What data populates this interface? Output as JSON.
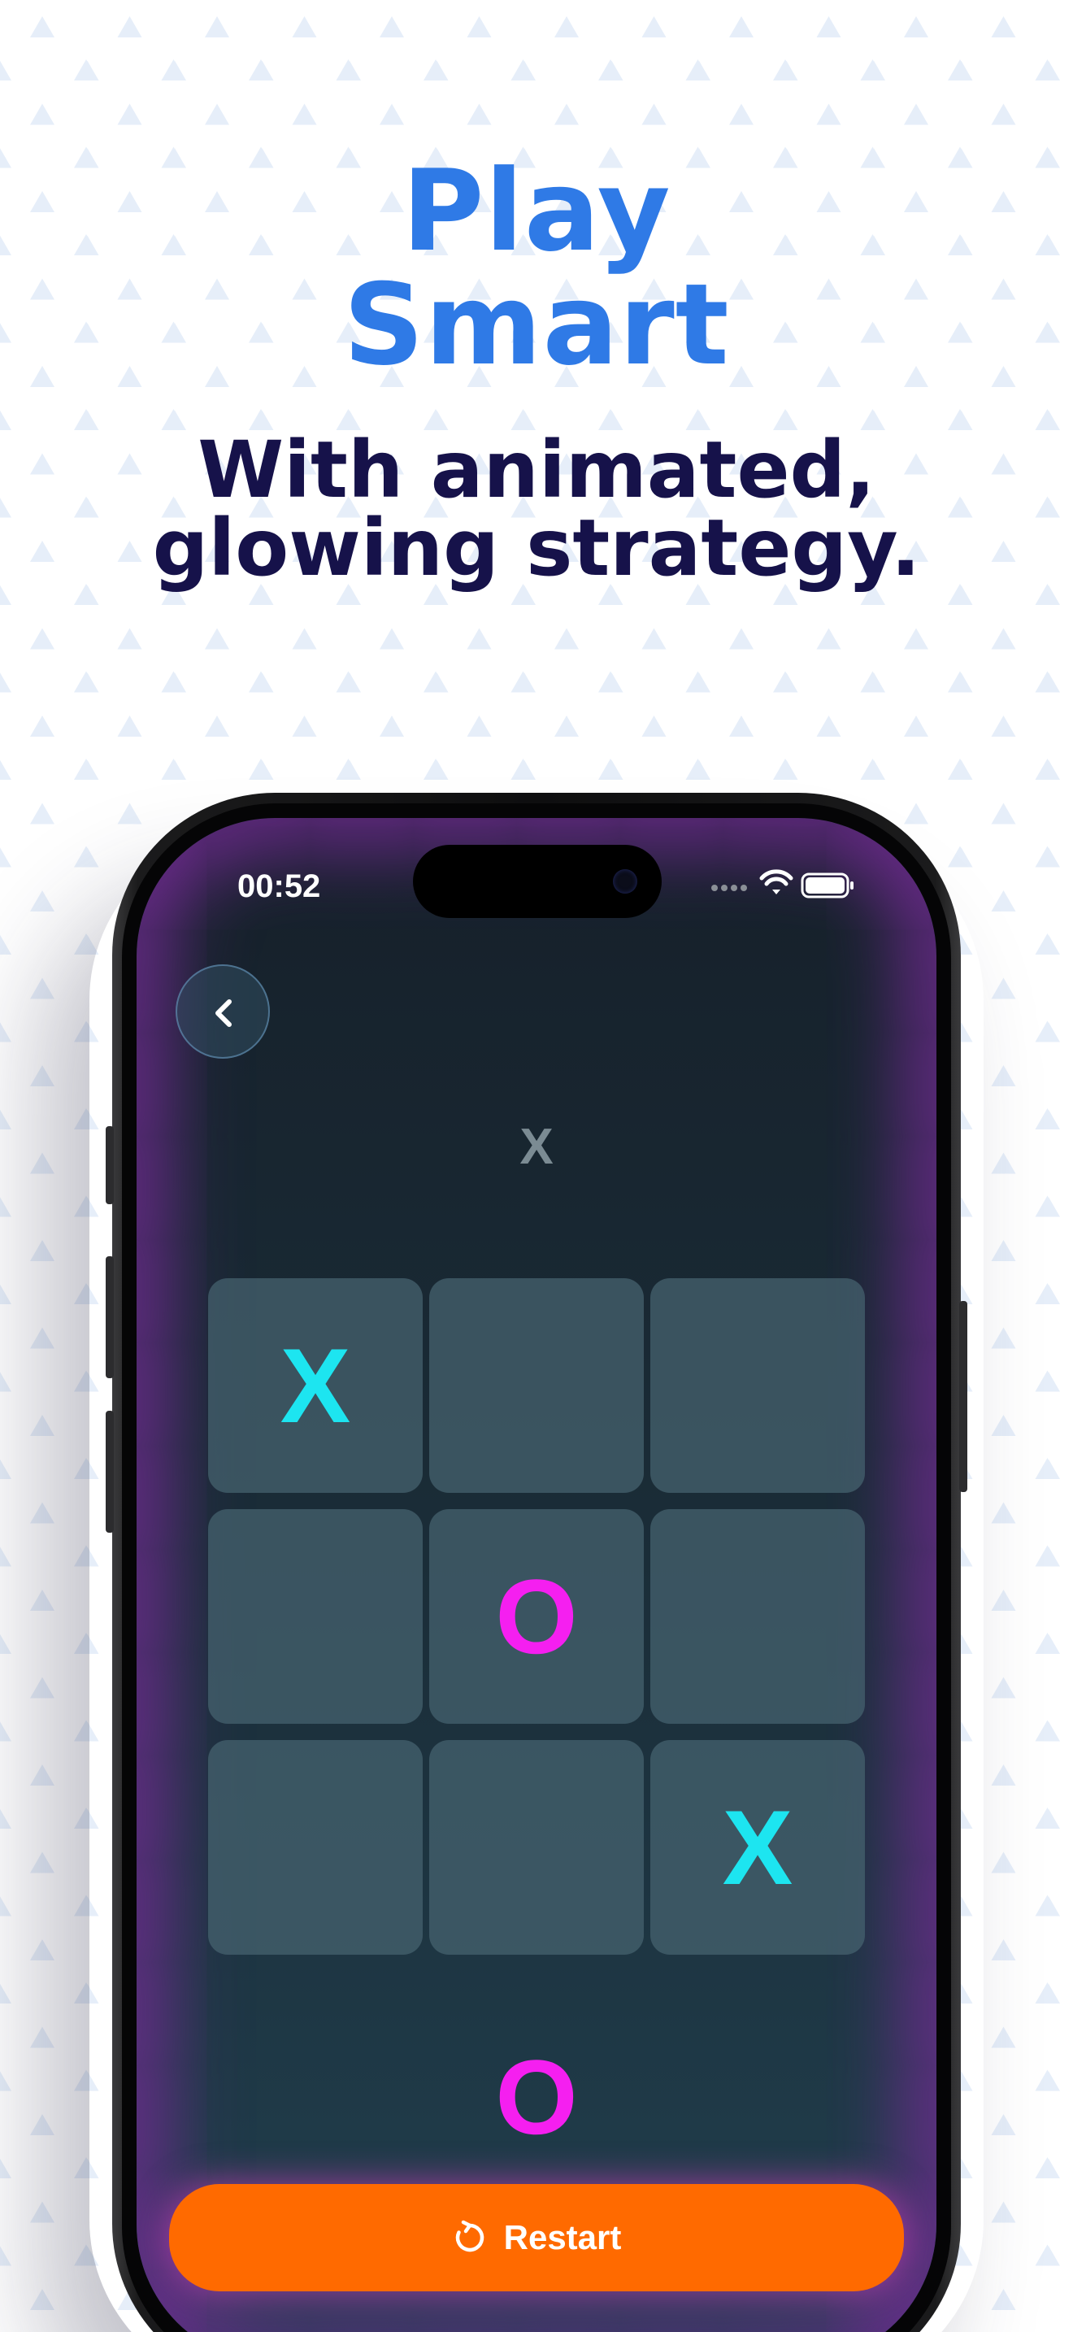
{
  "colors": {
    "headline": "#2f7ae6",
    "subline": "#16124a",
    "pattern": "#e6eef9",
    "screen_glow": "#762c96",
    "cell": "#466470",
    "mark_x": "#1de5f0",
    "mark_o": "#f51ff0",
    "restart_button": "#ff6a00"
  },
  "headline": {
    "line1": "Play",
    "line2": "Smart"
  },
  "subline": {
    "line1": "With animated,",
    "line2": "glowing strategy."
  },
  "phone": {
    "status_bar": {
      "time": "00:52",
      "icons": [
        "signal-dots-icon",
        "wifi-icon",
        "battery-icon"
      ]
    },
    "back_icon": "chevron-left-icon",
    "turn_label": "X",
    "board": {
      "cells": [
        [
          "X",
          "",
          ""
        ],
        [
          "",
          "O",
          ""
        ],
        [
          "",
          "",
          "X"
        ]
      ]
    },
    "bottom_mark": "O",
    "restart": {
      "icon": "restart-icon",
      "label": "Restart"
    }
  }
}
